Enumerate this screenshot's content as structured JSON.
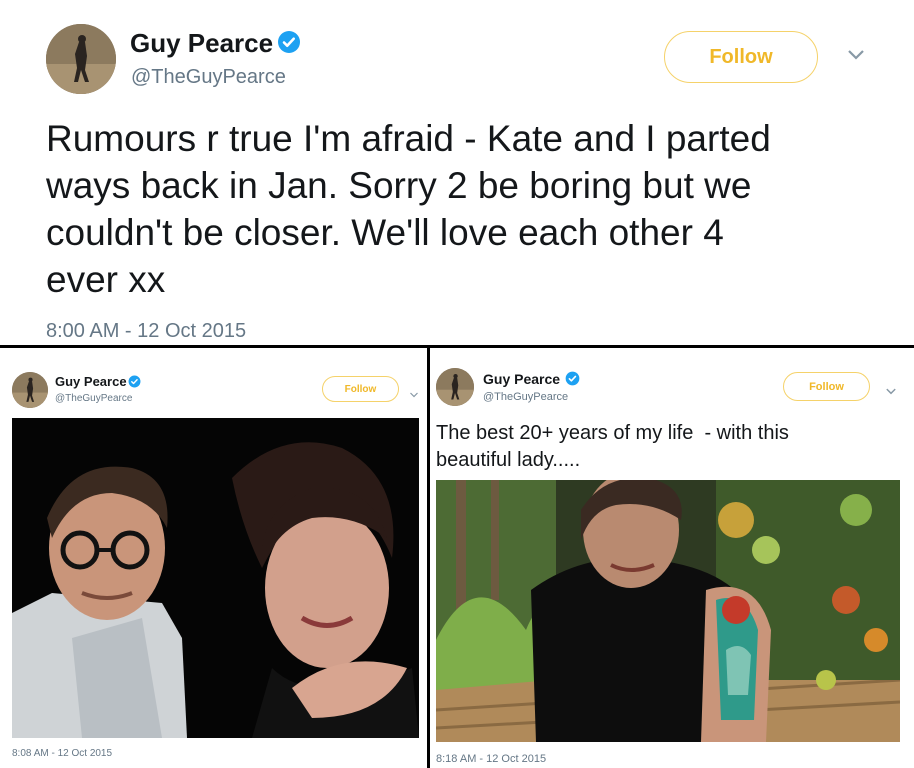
{
  "colors": {
    "follow": "#f0b829",
    "follow_border": "#f5d26a",
    "verified": "#1da1f2",
    "handle": "#657786",
    "divider": "#000000"
  },
  "top_tweet": {
    "name": "Guy Pearce",
    "handle": "@TheGuyPearce",
    "follow_label": "Follow",
    "text": "Rumours r true I'm afraid - Kate and I parted\nways back in Jan. Sorry 2 be boring but we\ncouldn't be closer. We'll love each other 4\never xx",
    "timestamp": "8:00 AM - 12 Oct 2015",
    "icons": [
      "verified-badge-icon",
      "chevron-down-icon"
    ]
  },
  "left_tweet": {
    "name": "Guy Pearce",
    "handle": "@TheGuyPearce",
    "follow_label": "Follow",
    "timestamp": "8:08 AM - 12 Oct 2015",
    "photo": "couple-photo"
  },
  "right_tweet": {
    "name": "Guy Pearce",
    "handle": "@TheGuyPearce",
    "follow_label": "Follow",
    "text": "The best 20+ years of my life  - with this\nbeautiful lady.....",
    "timestamp": "8:18 AM - 12 Oct 2015",
    "photo": "woman-garden-photo"
  }
}
